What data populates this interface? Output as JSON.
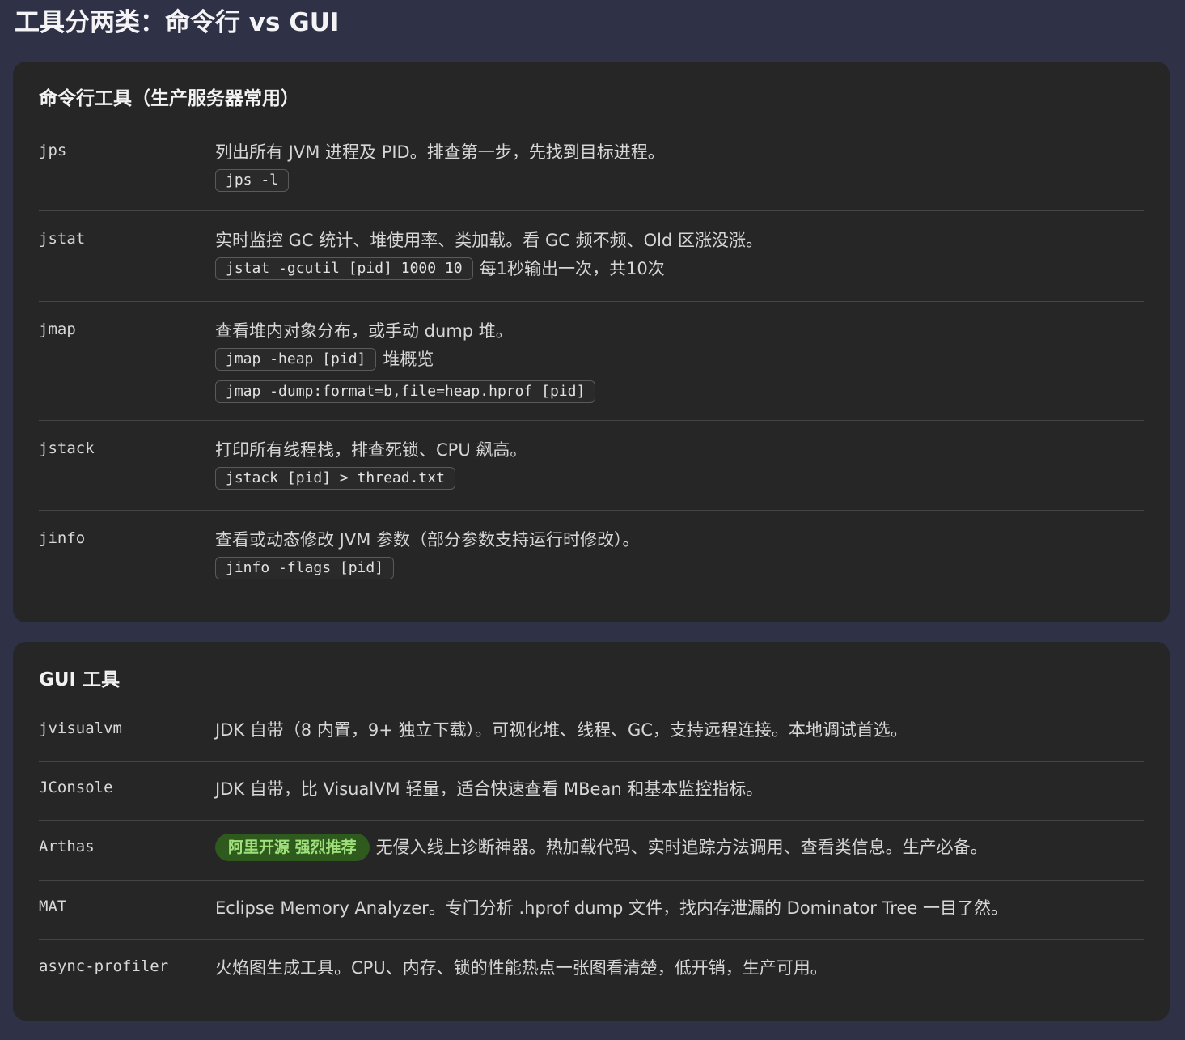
{
  "page": {
    "title": "工具分两类：命令行 vs GUI"
  },
  "cli": {
    "title": "命令行工具（生产服务器常用）",
    "tools": [
      {
        "name": "jps",
        "desc": "列出所有 JVM 进程及 PID。排查第一步，先找到目标进程。",
        "cmds": [
          {
            "code": "jps -l",
            "note": ""
          }
        ]
      },
      {
        "name": "jstat",
        "desc": "实时监控 GC 统计、堆使用率、类加载。看 GC 频不频、Old 区涨没涨。",
        "cmds": [
          {
            "code": "jstat -gcutil [pid] 1000 10",
            "note": "每1秒输出一次，共10次"
          }
        ]
      },
      {
        "name": "jmap",
        "desc": "查看堆内对象分布，或手动 dump 堆。",
        "cmds": [
          {
            "code": "jmap -heap [pid]",
            "note": "堆概览"
          },
          {
            "code": "jmap -dump:format=b,file=heap.hprof [pid]",
            "note": ""
          }
        ]
      },
      {
        "name": "jstack",
        "desc": "打印所有线程栈，排查死锁、CPU 飙高。",
        "cmds": [
          {
            "code": "jstack [pid] > thread.txt",
            "note": ""
          }
        ]
      },
      {
        "name": "jinfo",
        "desc": "查看或动态修改 JVM 参数（部分参数支持运行时修改）。",
        "cmds": [
          {
            "code": "jinfo -flags [pid]",
            "note": ""
          }
        ]
      }
    ]
  },
  "gui": {
    "title": "GUI 工具",
    "tools": [
      {
        "name": "jvisualvm",
        "badge": "",
        "desc": "JDK 自带（8 内置，9+ 独立下载）。可视化堆、线程、GC，支持远程连接。本地调试首选。"
      },
      {
        "name": "JConsole",
        "badge": "",
        "desc": "JDK 自带，比 VisualVM 轻量，适合快速查看 MBean 和基本监控指标。"
      },
      {
        "name": "Arthas",
        "badge": "阿里开源 强烈推荐",
        "desc": "无侵入线上诊断神器。热加载代码、实时追踪方法调用、查看类信息。生产必备。"
      },
      {
        "name": "MAT",
        "badge": "",
        "desc": "Eclipse Memory Analyzer。专门分析 .hprof dump 文件，找内存泄漏的 Dominator Tree 一目了然。"
      },
      {
        "name": "async-profiler",
        "badge": "",
        "desc": "火焰图生成工具。CPU、内存、锁的性能热点一张图看清楚，低开销，生产可用。"
      }
    ]
  },
  "colors": {
    "page_bg": "#2f3146",
    "card_bg": "#262626",
    "badge_bg": "#2f5a1e",
    "badge_text": "#9fe07a"
  }
}
